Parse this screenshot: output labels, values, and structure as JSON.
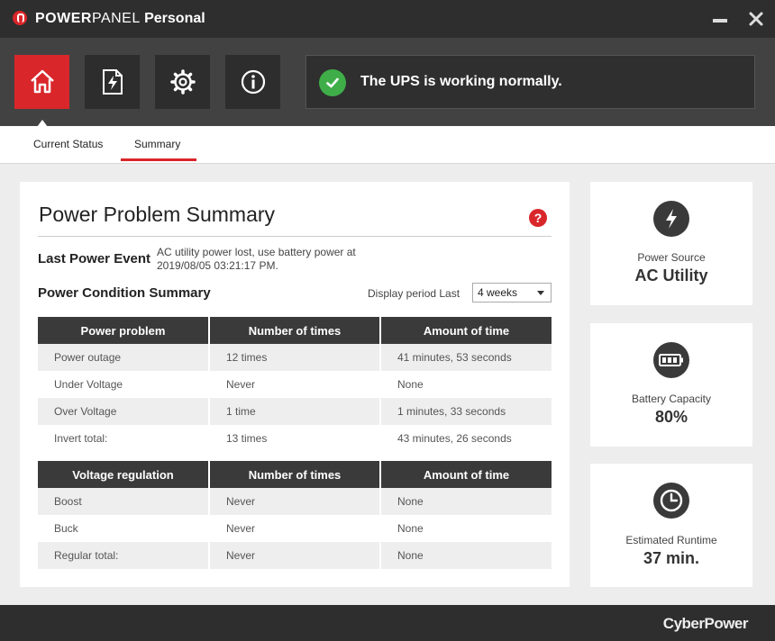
{
  "window": {
    "title_part1": "POWER",
    "title_part2": "PANEL",
    "title_part3": "Personal"
  },
  "toolbar": {
    "nav": [
      {
        "name": "home",
        "icon": "home-icon",
        "active": true
      },
      {
        "name": "power",
        "icon": "power-file-icon",
        "active": false
      },
      {
        "name": "settings",
        "icon": "gear-icon",
        "active": false
      },
      {
        "name": "about",
        "icon": "info-icon",
        "active": false
      }
    ],
    "status_text": "The UPS is working normally.",
    "colors": {
      "accent": "#d9262a",
      "ok": "#3fae49"
    }
  },
  "tabs": [
    {
      "label": "Current Status",
      "active": false
    },
    {
      "label": "Summary",
      "active": true
    }
  ],
  "summary": {
    "title": "Power Problem Summary",
    "help": "?",
    "last_event_label": "Last Power Event",
    "last_event_value": "AC utility power lost, use battery power at 2019/08/05 03:21:17 PM.",
    "condition_label": "Power Condition Summary",
    "period_label": "Display period Last",
    "period_value": "4 weeks"
  },
  "problem_table": {
    "headers": [
      "Power problem",
      "Number of times",
      "Amount of time"
    ],
    "rows": [
      [
        "Power outage",
        "12 times",
        "41 minutes, 53 seconds"
      ],
      [
        "Under Voltage",
        "Never",
        "None"
      ],
      [
        "Over Voltage",
        "1 time",
        "1 minutes, 33 seconds"
      ],
      [
        "Invert total:",
        "13 times",
        "43 minutes, 26 seconds"
      ]
    ]
  },
  "regulation_table": {
    "headers": [
      "Voltage regulation",
      "Number of times",
      "Amount of time"
    ],
    "rows": [
      [
        "Boost",
        "Never",
        "None"
      ],
      [
        "Buck",
        "Never",
        "None"
      ],
      [
        "Regular total:",
        "Never",
        "None"
      ]
    ]
  },
  "cards": {
    "power_source": {
      "label": "Power Source",
      "value": "AC Utility",
      "icon": "lightning-icon"
    },
    "battery": {
      "label": "Battery Capacity",
      "value": "80%",
      "icon": "battery-icon"
    },
    "runtime": {
      "label": "Estimated Runtime",
      "value": "37 min.",
      "icon": "clock-icon"
    }
  },
  "footer": {
    "brand": "CyberPower"
  }
}
